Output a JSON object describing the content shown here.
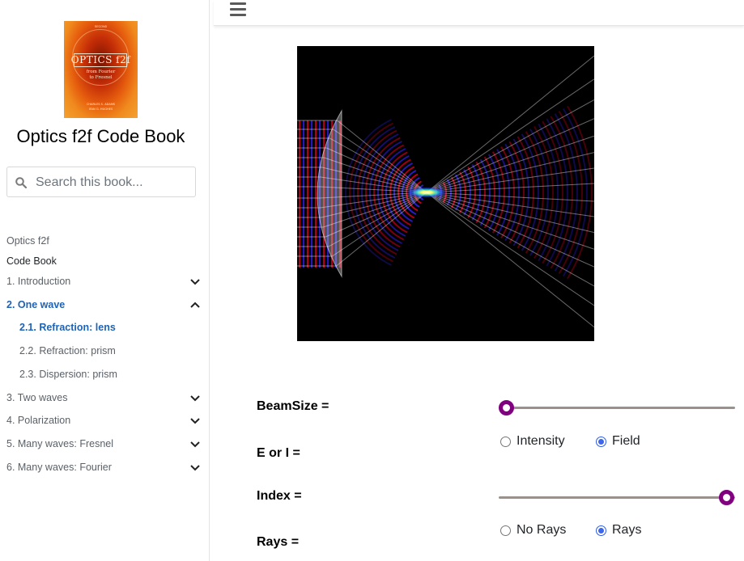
{
  "sidebar": {
    "cover": {
      "top_line": "SECOND",
      "title": "OPTICS f2f",
      "subtitle_1": "from Fourier",
      "subtitle_2": "to Fresnel",
      "authors_1": "CHARLES S. ADAMS",
      "authors_2": "IFAN G. HUGHES"
    },
    "book_title": "Optics f2f Code Book",
    "search": {
      "placeholder": "Search this book..."
    },
    "captions": [
      "Optics f2f",
      "Code Book"
    ],
    "items": [
      {
        "label": "1. Introduction",
        "expanded": false
      },
      {
        "label": "2. One wave",
        "expanded": true,
        "active": true
      },
      {
        "label": "2.1. Refraction: lens",
        "active": true
      },
      {
        "label": "2.2. Refraction: prism"
      },
      {
        "label": "2.3. Dispersion: prism"
      },
      {
        "label": "3. Two waves",
        "expanded": false
      },
      {
        "label": "4. Polarization",
        "expanded": false
      },
      {
        "label": "5. Many waves: Fresnel",
        "expanded": false
      },
      {
        "label": "6. Many waves: Fourier",
        "expanded": false
      }
    ]
  },
  "controls": {
    "beamsize": {
      "label": "BeamSize =",
      "value_fraction": 0.0
    },
    "e_or_i": {
      "label": "E or I =",
      "options": [
        "Intensity",
        "Field"
      ],
      "selected": "Field"
    },
    "index": {
      "label": "Index =",
      "value_fraction": 1.0
    },
    "rays": {
      "label": "Rays =",
      "options": [
        "No Rays",
        "Rays"
      ],
      "selected": "Rays"
    }
  },
  "colors": {
    "accent": "#1e63b5",
    "slider_thumb": "#800080",
    "radio": "#3d67e8"
  }
}
